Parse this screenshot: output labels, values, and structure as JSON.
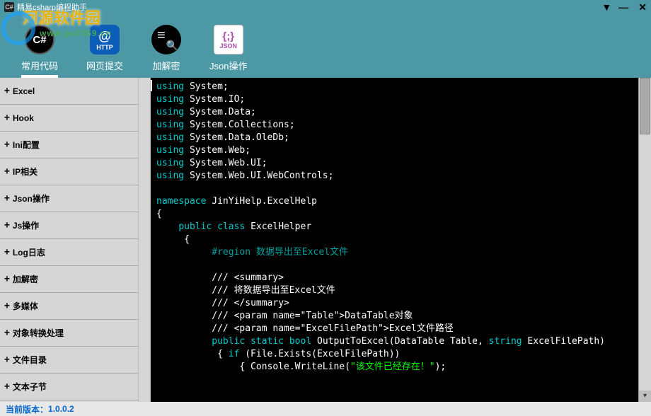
{
  "window": {
    "title": "精易csharp编程助手",
    "icon_label": "C#"
  },
  "watermark": {
    "line1": "河源软件园",
    "line2": "www.pc0359.cn"
  },
  "toolbar": [
    {
      "label": "常用代码",
      "icon": "csharp",
      "active": true
    },
    {
      "label": "网页提交",
      "icon": "http",
      "active": false
    },
    {
      "label": "加解密",
      "icon": "crypt",
      "active": false
    },
    {
      "label": "Json操作",
      "icon": "json",
      "active": false
    }
  ],
  "sidebar": [
    "Excel",
    "Hook",
    "Ini配置",
    "IP相关",
    "Json操作",
    "Js操作",
    "Log日志",
    "加解密",
    "多媒体",
    "对象转换处理",
    "文件目录",
    "文本子节"
  ],
  "code": {
    "usings": [
      "System",
      "System.IO",
      "System.Data",
      "System.Collections",
      "System.Data.OleDb",
      "System.Web",
      "System.Web.UI",
      "System.Web.UI.WebControls"
    ],
    "namespace_kw": "namespace",
    "namespace_name": "JinYiHelp.ExcelHelp",
    "class_mods": "public class",
    "class_name": "ExcelHelper",
    "region_kw": "#region",
    "region_text": "数据导出至Excel文件",
    "doc1": "/// <summary>",
    "doc2": "/// 将数据导出至Excel文件",
    "doc3": "/// </summary>",
    "doc4": "/// <param name=\"Table\">DataTable对象",
    "doc5": "/// <param name=\"ExcelFilePath\">Excel文件路径",
    "method_mods": "public static bool",
    "method_name": "OutputToExcel",
    "method_args_open": "(DataTable Table, ",
    "method_arg_type": "string",
    "method_args_close": " ExcelFilePath)",
    "if_kw": "if",
    "if_cond": " (File.Exists(ExcelFilePath))",
    "console": "Console.WriteLine(",
    "console_str": "\"该文件已经存在！\"",
    "console_close": ");"
  },
  "status": {
    "label": "当前版本：",
    "version": "1.0.0.2"
  }
}
